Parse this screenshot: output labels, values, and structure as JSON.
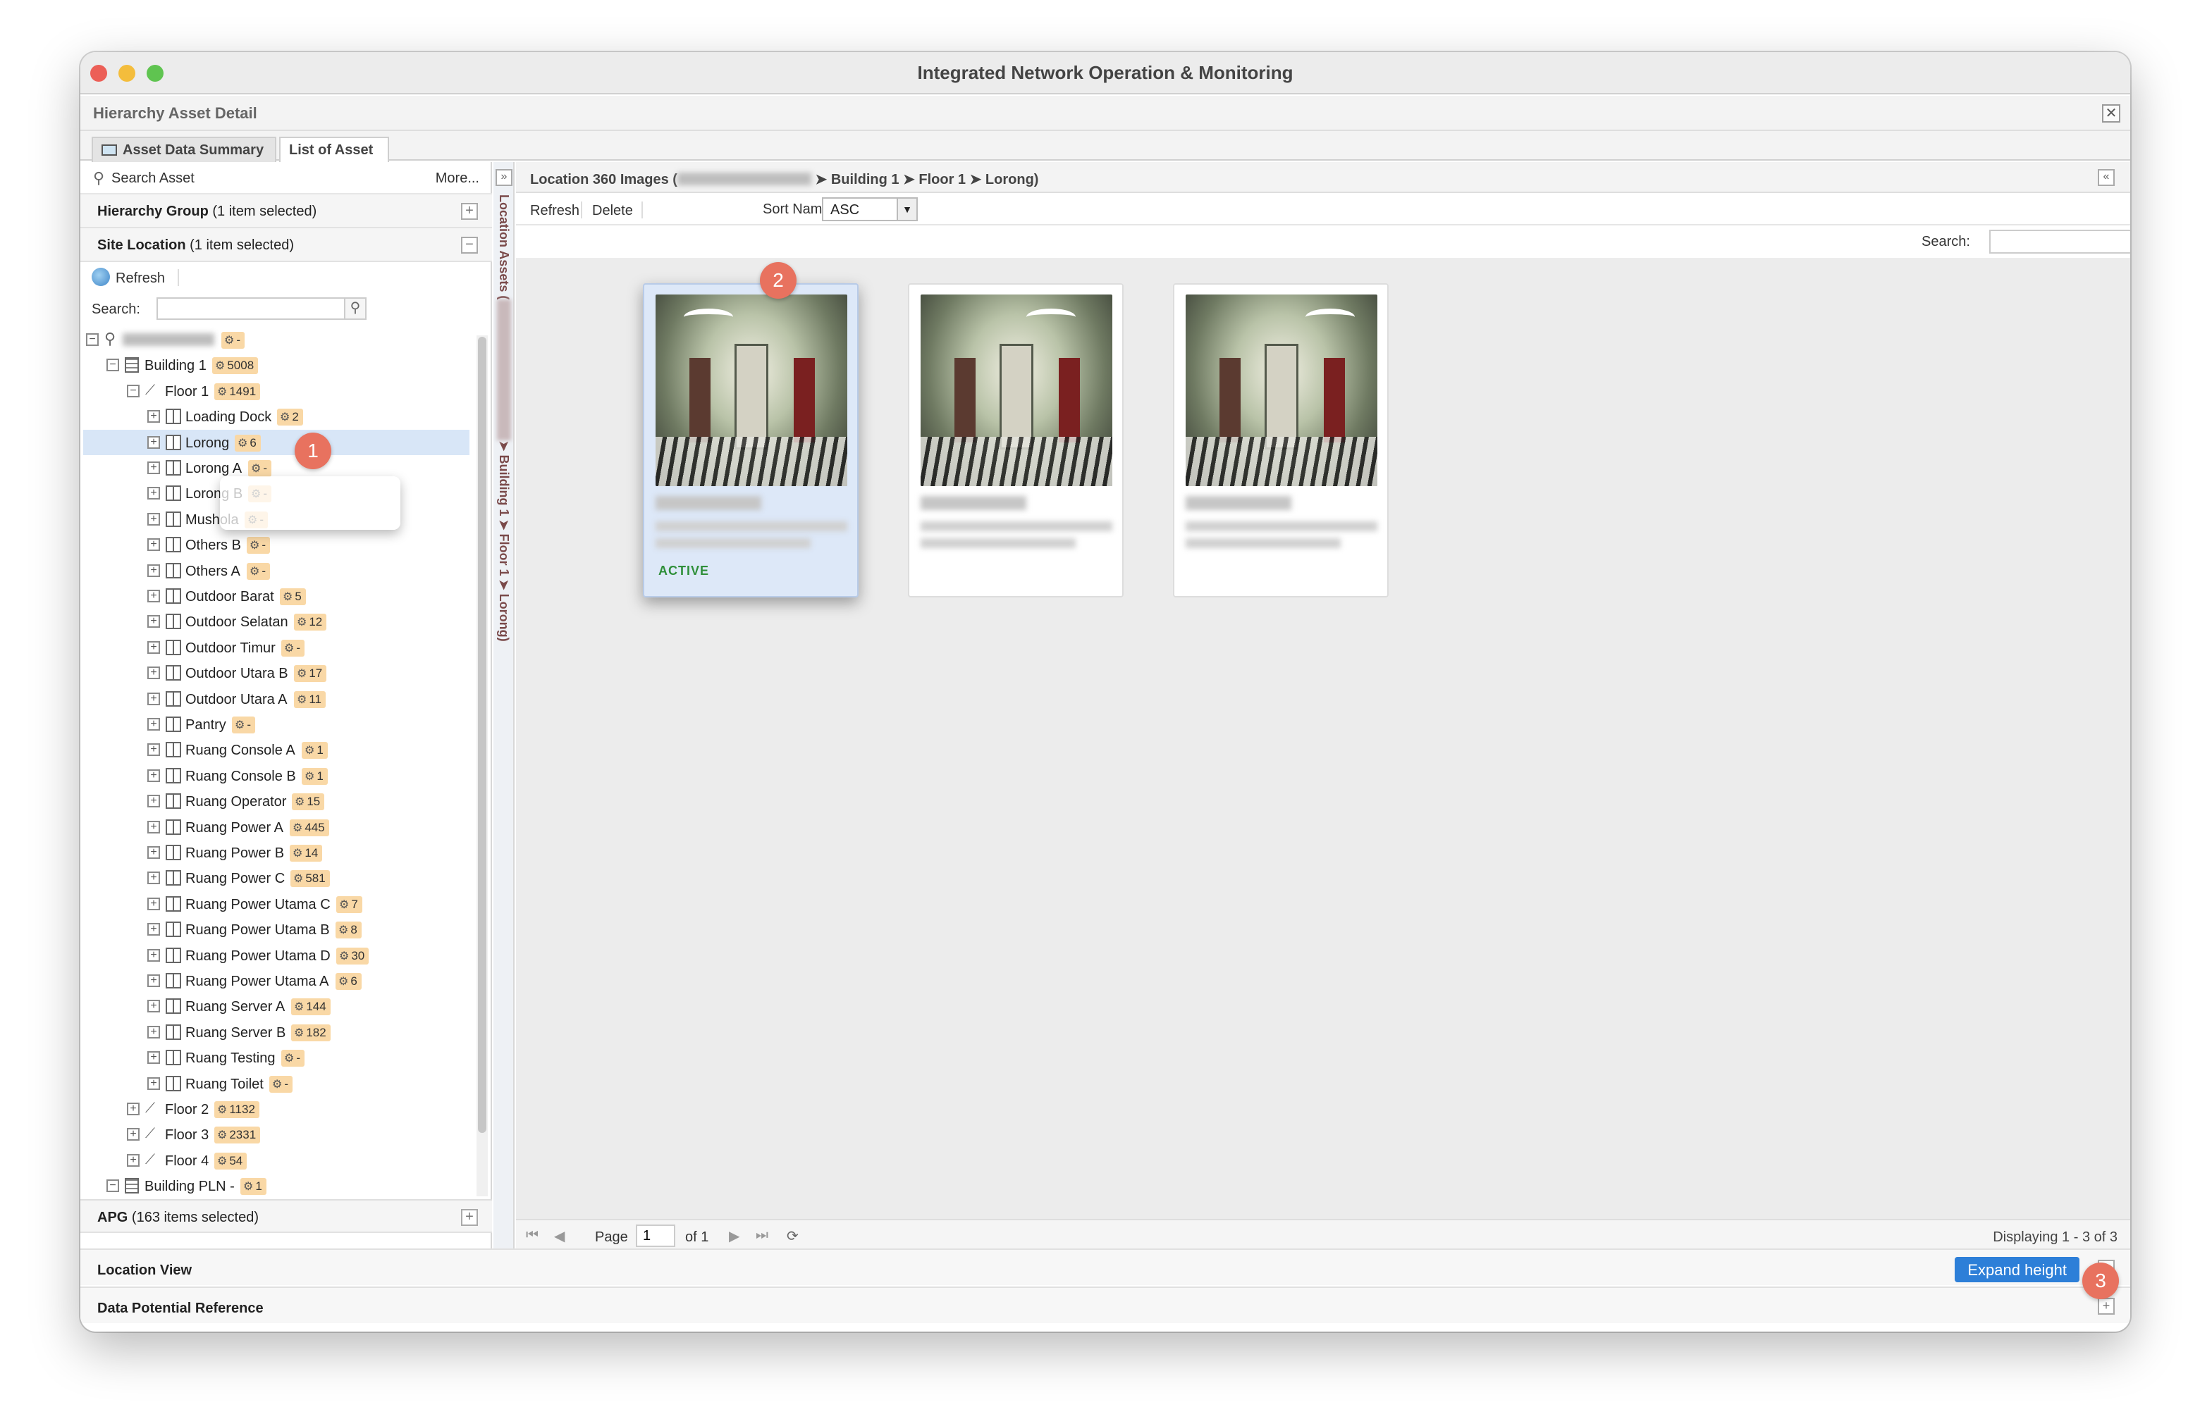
{
  "window": {
    "title": "Integrated Network Operation & Monitoring"
  },
  "panel": {
    "title": "Hierarchy Asset Detail",
    "close": "✕"
  },
  "tabs": [
    {
      "label": "Asset Data Summary"
    },
    {
      "label": "List of Asset"
    }
  ],
  "left": {
    "search_asset": "Search Asset",
    "more": "More...",
    "hierarchy_group": {
      "label": "Hierarchy Group",
      "sel": "(1 item selected)"
    },
    "site_location": {
      "label": "Site Location",
      "sel": "(1 item selected)"
    },
    "refresh": "Refresh",
    "search_label": "Search:",
    "apg": {
      "label": "APG",
      "sel": "(163 items selected)"
    },
    "tree": {
      "root_badge": "-",
      "building1": {
        "label": "Building 1",
        "badge": "5008"
      },
      "floor1": {
        "label": "Floor 1",
        "badge": "1491"
      },
      "rooms": [
        {
          "label": "Loading Dock",
          "badge": "2"
        },
        {
          "label": "Lorong",
          "badge": "6"
        },
        {
          "label": "Lorong A",
          "badge": "-"
        },
        {
          "label": "Lorong B",
          "badge": "-"
        },
        {
          "label": "Mushola",
          "badge": "-"
        },
        {
          "label": "Others B",
          "badge": "-"
        },
        {
          "label": "Others A",
          "badge": "-"
        },
        {
          "label": "Outdoor Barat",
          "badge": "5"
        },
        {
          "label": "Outdoor Selatan",
          "badge": "12"
        },
        {
          "label": "Outdoor Timur",
          "badge": "-"
        },
        {
          "label": "Outdoor Utara B",
          "badge": "17"
        },
        {
          "label": "Outdoor Utara A",
          "badge": "11"
        },
        {
          "label": "Pantry",
          "badge": "-"
        },
        {
          "label": "Ruang Console A",
          "badge": "1"
        },
        {
          "label": "Ruang Console B",
          "badge": "1"
        },
        {
          "label": "Ruang Operator",
          "badge": "15"
        },
        {
          "label": "Ruang Power A",
          "badge": "445"
        },
        {
          "label": "Ruang Power B",
          "badge": "14"
        },
        {
          "label": "Ruang Power C",
          "badge": "581"
        },
        {
          "label": "Ruang Power Utama C",
          "badge": "7"
        },
        {
          "label": "Ruang Power Utama B",
          "badge": "8"
        },
        {
          "label": "Ruang Power Utama D",
          "badge": "30"
        },
        {
          "label": "Ruang Power Utama A",
          "badge": "6"
        },
        {
          "label": "Ruang Server A",
          "badge": "144"
        },
        {
          "label": "Ruang Server B",
          "badge": "182"
        },
        {
          "label": "Ruang Testing",
          "badge": "-"
        },
        {
          "label": "Ruang Toilet",
          "badge": "-"
        }
      ],
      "floor2": {
        "label": "Floor 2",
        "badge": "1132"
      },
      "floor3": {
        "label": "Floor 3",
        "badge": "2331"
      },
      "floor4": {
        "label": "Floor 4",
        "badge": "54"
      },
      "building_pln": {
        "label": "Building PLN -",
        "badge": "1"
      }
    }
  },
  "strip": {
    "prefix": "Location Assets (",
    "suffix": "➤ Building 1 ➤ Floor 1 ➤ Lorong)"
  },
  "right": {
    "title_prefix": "Location 360 Images (",
    "title_suffix": "➤ Building 1 ➤ Floor 1 ➤ Lorong)",
    "refresh": "Refresh",
    "delete": "Delete",
    "sort_label": "Sort Name:",
    "sort_value": "ASC",
    "search_label": "Search:",
    "cards": [
      {
        "status": "ACTIVE"
      },
      {
        "status": ""
      },
      {
        "status": ""
      }
    ],
    "pager": {
      "page_label": "Page",
      "page_value": "1",
      "of": "of 1",
      "display": "Displaying 1 - 3 of 3"
    }
  },
  "bottom": {
    "location_view": "Location View",
    "expand_height": "Expand height",
    "data_potential": "Data Potential Reference"
  },
  "callouts": [
    "1",
    "2",
    "3"
  ]
}
